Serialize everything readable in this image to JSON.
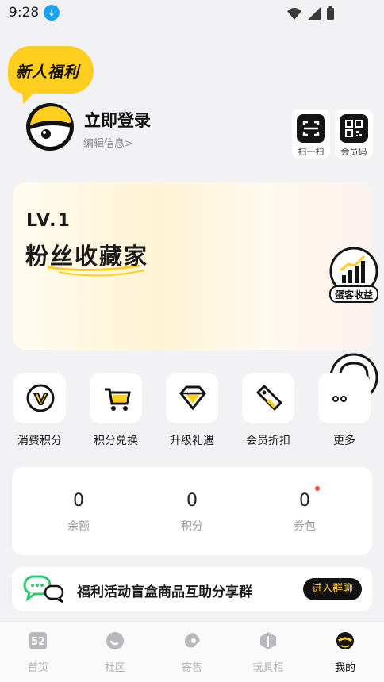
{
  "status_bar": {
    "time": "9:28"
  },
  "promo_badge": {
    "text": "新人福利"
  },
  "profile": {
    "login_label": "立即登录",
    "edit_label": "编辑信息>"
  },
  "header_actions": [
    {
      "label": "扫一扫",
      "icon": "scan-icon"
    },
    {
      "label": "会员码",
      "icon": "qr-code-icon"
    }
  ],
  "member_card": {
    "level": "LV.1",
    "title": "粉丝收藏家"
  },
  "floating": {
    "earnings_label": "蛋客收益"
  },
  "quick_actions": [
    {
      "label": "消费积分",
      "icon": "points-v-icon"
    },
    {
      "label": "积分兑换",
      "icon": "cart-icon"
    },
    {
      "label": "升级礼遇",
      "icon": "diamond-icon"
    },
    {
      "label": "会员折扣",
      "icon": "tag-icon"
    },
    {
      "label": "更多",
      "icon": "more-icon"
    }
  ],
  "assets": [
    {
      "value": "0",
      "label": "余额"
    },
    {
      "value": "0",
      "label": "积分"
    },
    {
      "value": "0",
      "label": "券包"
    }
  ],
  "group_banner": {
    "text": "福利活动盲盒商品互助分享群",
    "button": "进入群聊"
  },
  "tabbar": [
    {
      "label": "首页",
      "icon": "home-52-icon",
      "active": false
    },
    {
      "label": "社区",
      "icon": "community-icon",
      "active": false
    },
    {
      "label": "寄售",
      "icon": "consign-icon",
      "active": false
    },
    {
      "label": "玩具柜",
      "icon": "toy-cabinet-icon",
      "active": false
    },
    {
      "label": "我的",
      "icon": "mine-icon",
      "active": true
    }
  ],
  "colors": {
    "accent_yellow": "#ffce1f",
    "dark": "#111111",
    "notice_red": "#ff4a3d"
  }
}
